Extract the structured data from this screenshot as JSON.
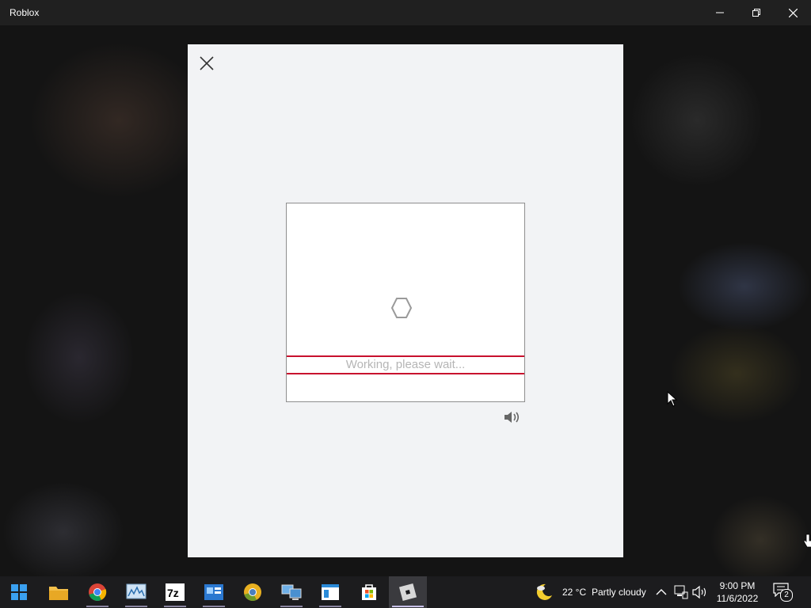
{
  "window": {
    "title": "Roblox"
  },
  "dialog": {
    "status_text": "Working, please wait..."
  },
  "taskbar": {
    "apps": [
      "start-icon",
      "file-explorer-icon",
      "chrome-icon",
      "resource-monitor-icon",
      "7zip-icon",
      "control-panel-icon",
      "chrome-canary-icon",
      "network-icon",
      "notepad-icon",
      "microsoft-store-icon",
      "roblox-icon"
    ],
    "weather": {
      "temp": "22 °C",
      "condition": "Partly cloudy"
    },
    "time": "9:00 PM",
    "date": "11/6/2022",
    "notifications_count": "2"
  },
  "colors": {
    "status_border": "#c8102e",
    "dialog_bg": "#f2f3f5"
  }
}
